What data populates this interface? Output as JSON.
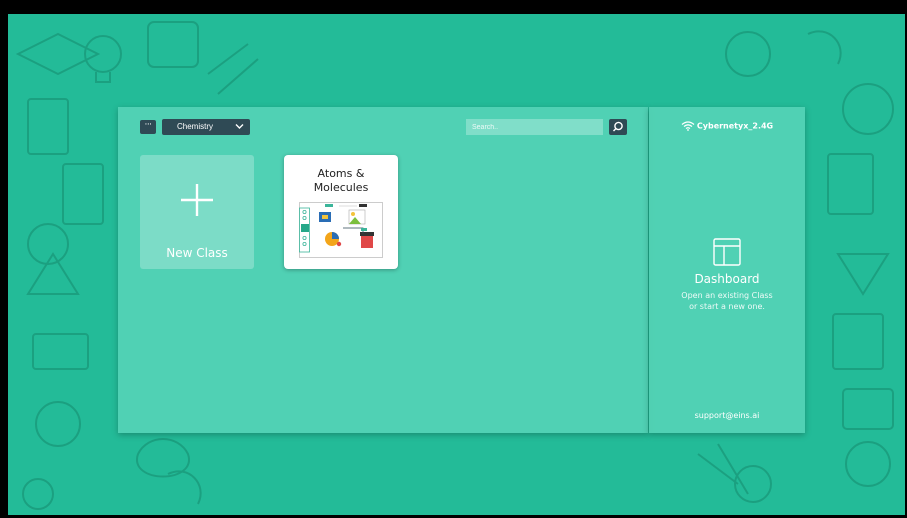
{
  "toolbar": {
    "menu_label": "···",
    "selected_class": "Chemistry",
    "search_placeholder": "Search.."
  },
  "cards": {
    "new_class_label": "New Class",
    "classes": [
      {
        "title_line1": "Atoms &",
        "title_line2": "Molecules"
      }
    ]
  },
  "side": {
    "wifi_name": "Cybernetyx_2.4G",
    "dashboard_title": "Dashboard",
    "dashboard_subtitle_line1": "Open an existing Class",
    "dashboard_subtitle_line2": "or start a new one.",
    "support_email": "support@eins.ai"
  },
  "icons": [
    "wifi-icon",
    "dashboard-icon",
    "search-icon",
    "plus-icon",
    "chevron-down-icon",
    "more-icon"
  ],
  "colors": {
    "background": "#23bb98",
    "panel": "#56d4b7",
    "control_dark": "#2f4a55"
  }
}
